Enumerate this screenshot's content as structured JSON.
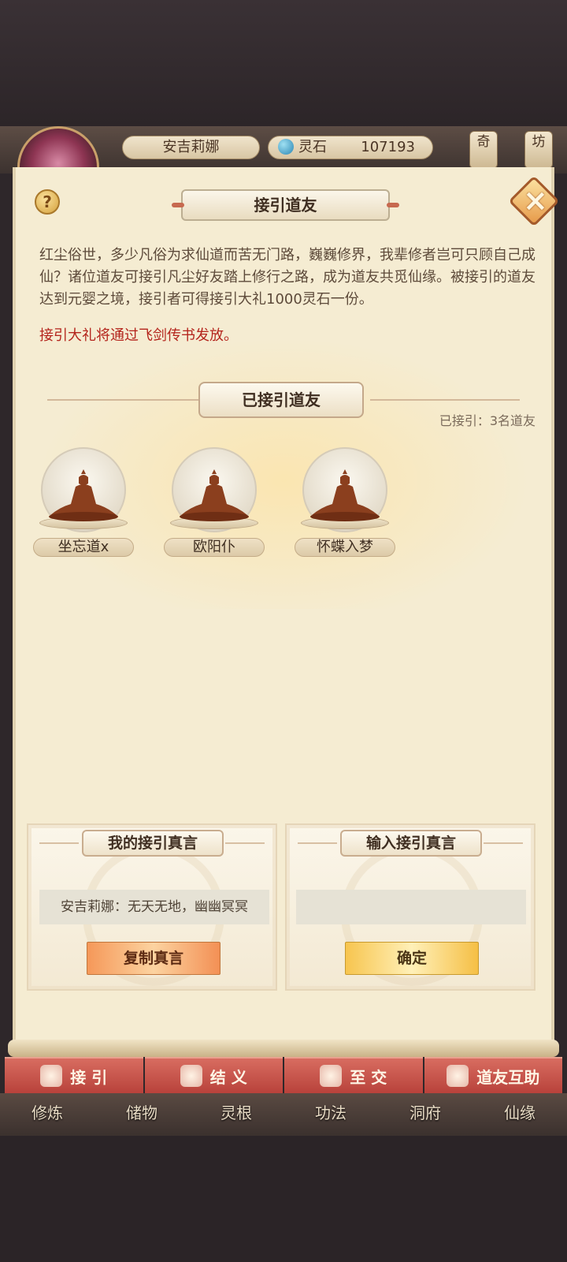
{
  "hud": {
    "player_name": "安吉莉娜",
    "currency_label": "灵石",
    "currency_value": "107193",
    "right_tabs": [
      "奇",
      "坊"
    ]
  },
  "dialog": {
    "help_icon": "?",
    "title": "接引道友",
    "close_icon": "close-icon",
    "intro": "红尘俗世，多少凡俗为求仙道而苦无门路，巍巍修界，我辈修者岂可只顾自己成仙？诸位道友可接引凡尘好友踏上修行之路，成为道友共觅仙缘。被接引的道友达到元婴之境，接引者可得接引大礼1000灵石一份。",
    "notice": "接引大礼将通过飞剑传书发放。",
    "section_title": "已接引道友",
    "invited_count": "已接引：3名道友",
    "friends": [
      {
        "name": "坐忘道x"
      },
      {
        "name": "欧阳仆"
      },
      {
        "name": "怀蝶入梦"
      }
    ]
  },
  "my_code_card": {
    "title": "我的接引真言",
    "code": "安吉莉娜：无天无地，幽幽冥冥",
    "button": "复制真言"
  },
  "input_code_card": {
    "title": "输入接引真言",
    "placeholder": "",
    "button": "确定"
  },
  "sub_tabs": [
    {
      "label": "接 引",
      "icon": "person-icon"
    },
    {
      "label": "结 义",
      "icon": "hands-icon"
    },
    {
      "label": "至 交",
      "icon": "heart-icon"
    },
    {
      "label": "道友互助",
      "icon": "help-icon"
    }
  ],
  "bottom_nav": [
    "修炼",
    "储物",
    "灵根",
    "功法",
    "洞府",
    "仙缘"
  ],
  "colors": {
    "panel_bg": "#f5ecd2",
    "notice_red": "#b4241c",
    "tab_red": "#c4524a",
    "copy_button": "#f59859",
    "confirm_button": "#f7c54f"
  }
}
